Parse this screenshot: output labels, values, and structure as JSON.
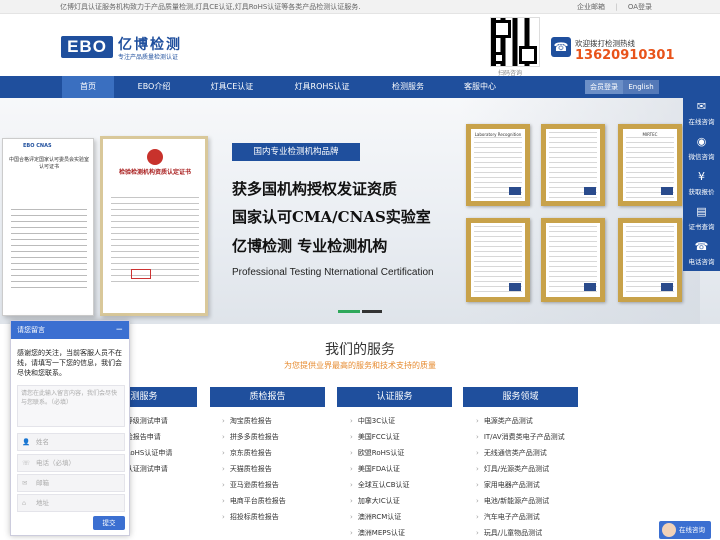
{
  "topbar": {
    "intro": "亿博灯具认证服务机构致力于产品质量检测,灯具CE认证,灯具RoHS认证等各类产品检测认证服务.",
    "links": [
      "企业邮箱",
      "OA登录"
    ],
    "separator": "|"
  },
  "header": {
    "logo_text": "EBO",
    "company_name": "亿博检测",
    "slogan": "专注产品质量检测认证",
    "qr_label": "扫码咨询",
    "hotline_label": "欢迎拨打检测热线",
    "hotline_number": "13620910301"
  },
  "nav": {
    "items": [
      "首页",
      "EBO介绍",
      "灯具CE认证",
      "灯具ROHS认证",
      "检测服务",
      "客服中心"
    ],
    "active_index": 0,
    "member_label": "会员登录",
    "english_label": "English"
  },
  "banner": {
    "tag": "国内专业检测机构品牌",
    "line1": "获多国机构授权发证资质",
    "line2": "国家认可CMA/CNAS实验室",
    "line3": "亿博检测  专业检测机构",
    "english": "Professional Testing Nternational Certification",
    "cert_a_logos": "EBO CNAS",
    "cert_a_title": "中国合格评定国家认可委员会实验室认可证书",
    "cert_b_title": "检验检测机构资质认定证书",
    "frame_titles": [
      "Laboratory Recognition",
      "",
      "MIRTEC",
      "",
      "",
      ""
    ]
  },
  "services": {
    "title": "我们的服务",
    "subtitle": "为您提供业界最高的服务和技术支持的质量",
    "columns": [
      {
        "heading": "检测服务",
        "items": [
          "等级测试申请",
          "检报告申请",
          "RoHS认证申请",
          "认证测试申请"
        ]
      },
      {
        "heading": "质检报告",
        "items": [
          "淘宝质检报告",
          "拼多多质检报告",
          "京东质检报告",
          "天猫质检报告",
          "亚马逊质检报告",
          "电商平台质检报告",
          "招投标质检报告"
        ]
      },
      {
        "heading": "认证服务",
        "items": [
          "中国3C认证",
          "美国FCC认证",
          "欧盟RoHS认证",
          "美国FDA认证",
          "全球互认CB认证",
          "加拿大IC认证",
          "澳洲RCM认证",
          "澳洲MEPS认证"
        ]
      },
      {
        "heading": "服务领域",
        "items": [
          "电源类产品测试",
          "IT/AV消费类电子产品测试",
          "无线通信类产品测试",
          "灯具/光源类产品测试",
          "家用电器产品测试",
          "电池/新能源产品测试",
          "汽车电子产品测试",
          "玩具/儿童物品测试"
        ]
      }
    ]
  },
  "float_bar": {
    "items": [
      {
        "label": "在线咨询",
        "icon": "chat-icon"
      },
      {
        "label": "微信咨询",
        "icon": "wechat-icon"
      },
      {
        "label": "获取报价",
        "icon": "price-icon"
      },
      {
        "label": "证书查询",
        "icon": "certificate-icon"
      },
      {
        "label": "电话咨询",
        "icon": "phone-icon"
      }
    ]
  },
  "chat": {
    "title": "请您留言",
    "minimize": "−",
    "message": "感谢您的关注，当前客服人员不在线，请填写一下您的信息，我们会尽快和您联系。",
    "textarea_placeholder": "请您在此输入留言内容，我们会尽快与您联系。（必填）",
    "fields": [
      "姓名",
      "电话（必填）",
      "邮箱",
      "地址"
    ],
    "send_label": "提交"
  },
  "online_badge": {
    "label": "在线咨询"
  },
  "colors": {
    "brand_blue": "#1f4f9d",
    "hotline_orange": "#e8531a",
    "subtitle_orange": "#e68a2e",
    "chat_blue": "#3b6fd1"
  }
}
